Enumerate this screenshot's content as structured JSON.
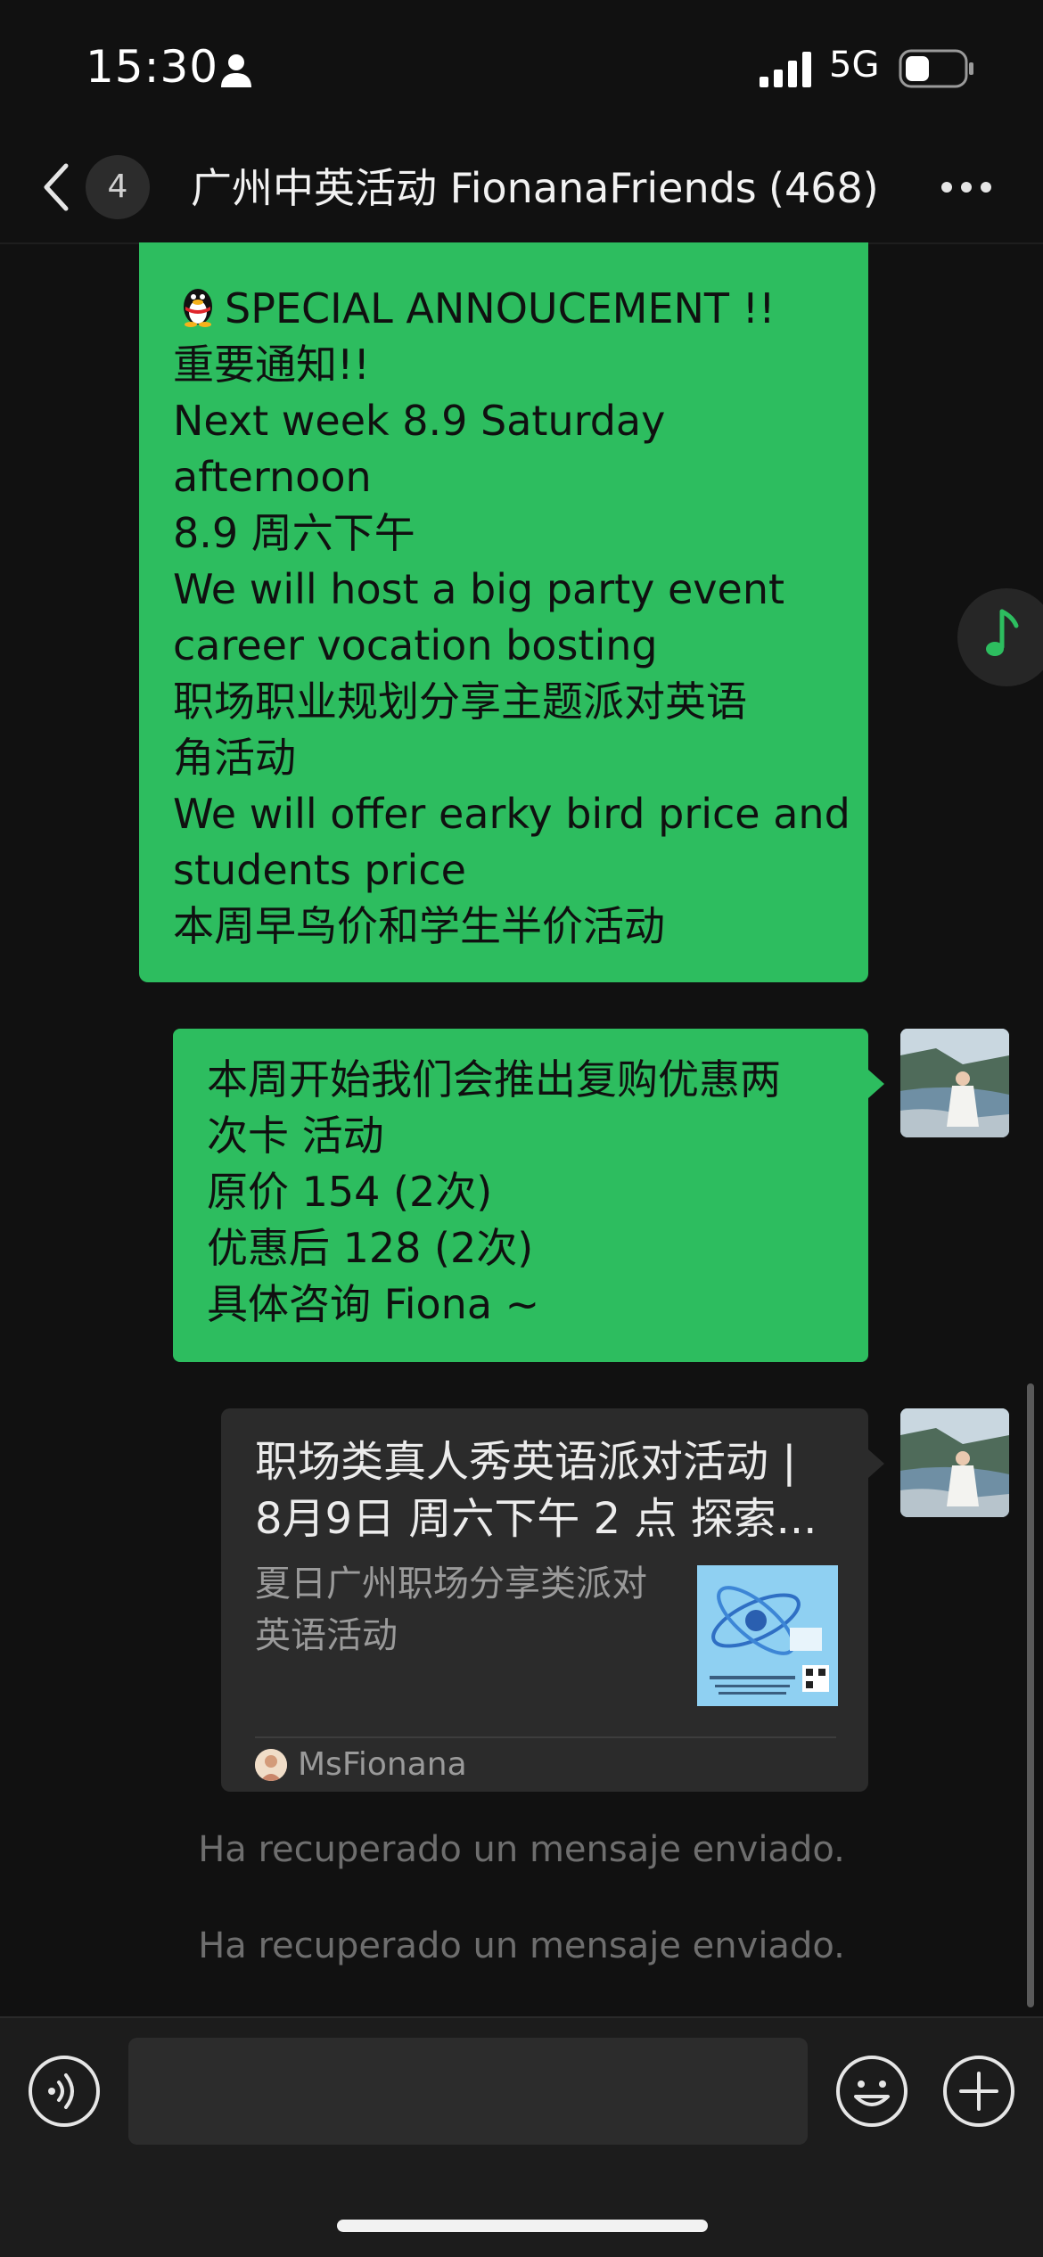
{
  "status_bar": {
    "time": "15:30",
    "network": "5G",
    "icons": [
      "person-icon",
      "signal-icon",
      "battery-icon"
    ]
  },
  "nav": {
    "unread_count": "4",
    "title": "广州中英活动 FionanaFriends",
    "member_count": "(468)",
    "icons": [
      "back-icon",
      "more-icon"
    ]
  },
  "messages": [
    {
      "lines": [
        "SPECIAL ANNOUCEMENT !!",
        "重要通知!!",
        "Next week 8.9 Saturday",
        "afternoon",
        "8.9 周六下午",
        "We will host a big party event",
        "career vocation bosting",
        "职场职业规划分享主题派对英语",
        "角活动",
        "We will offer earky bird price and",
        "students price",
        "本周早鸟价和学生半价活动"
      ],
      "leading_icon": "penguin-icon"
    },
    {
      "lines": [
        "本周开始我们会推出复购优惠两",
        "次卡 活动",
        "原价 154 (2次)",
        "优惠后 128 (2次)",
        "具体咨询 Fiona ~"
      ]
    }
  ],
  "link_card": {
    "title_lines": [
      "职场类真人秀英语派对活动 |",
      "8月9日 周六下午 2 点 探索..."
    ],
    "description": "夏日广州职场分享类派对英语活动",
    "source": "MsFionana"
  },
  "system_messages": [
    "Ha recuperado un mensaje enviado.",
    "Ha recuperado un mensaje enviado."
  ],
  "input": {
    "placeholder": "",
    "icons": [
      "voice-icon",
      "emoji-icon",
      "plus-icon"
    ]
  },
  "floating": {
    "icon": "music-note-icon"
  },
  "colors": {
    "background": "#111111",
    "bubble_green": "#2dbd5f",
    "card_bg": "#2b2b2b",
    "system_text": "#6e6e6e"
  }
}
